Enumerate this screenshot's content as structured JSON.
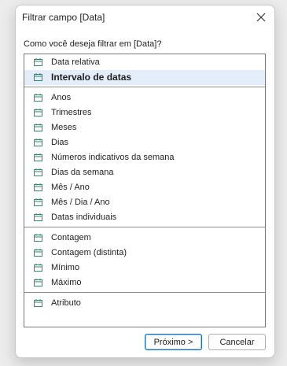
{
  "dialog": {
    "title": "Filtrar campo [Data]",
    "prompt": "Como você deseja filtrar em [Data]?",
    "close_icon": "close-icon"
  },
  "list": {
    "icon": "calendar-icon",
    "icon_color": "#2e8b6e",
    "selected_bg": "#e3eefa",
    "groups": [
      {
        "items": [
          {
            "label": "Data relativa"
          },
          {
            "label": "Intervalo de datas",
            "selected": true
          }
        ]
      },
      {
        "items": [
          {
            "label": "Anos"
          },
          {
            "label": "Trimestres"
          },
          {
            "label": "Meses"
          },
          {
            "label": "Dias"
          },
          {
            "label": "Números indicativos da semana"
          },
          {
            "label": "Dias da semana"
          },
          {
            "label": "Mês / Ano"
          },
          {
            "label": "Mês / Dia / Ano"
          },
          {
            "label": "Datas individuais"
          }
        ]
      },
      {
        "items": [
          {
            "label": "Contagem"
          },
          {
            "label": "Contagem (distinta)"
          },
          {
            "label": "Mínimo"
          },
          {
            "label": "Máximo"
          }
        ]
      },
      {
        "items": [
          {
            "label": "Atributo"
          }
        ]
      }
    ]
  },
  "buttons": {
    "next_label": "Próximo >",
    "cancel_label": "Cancelar"
  }
}
